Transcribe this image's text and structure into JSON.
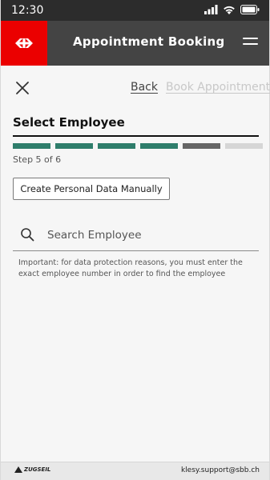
{
  "status_bar": {
    "time": "12:30",
    "icons": [
      "signal-icon",
      "wifi-icon",
      "battery-icon"
    ]
  },
  "header": {
    "title": "Appointment Booking",
    "logo_icon": "sbb-logo-icon",
    "brand_color": "#eb0000",
    "background_color": "#444444",
    "menu_icon": "menu-icon"
  },
  "nav": {
    "close_icon": "close-icon",
    "back_label": "Back",
    "book_label": "Book Appointment"
  },
  "main": {
    "title": "Select Employee",
    "progress": {
      "current": 5,
      "total": 6,
      "segments": [
        "complete",
        "complete",
        "complete",
        "complete",
        "current",
        "pending"
      ],
      "colors": {
        "complete": "#2e7d6b",
        "current": "#666666",
        "pending": "#d6d6d6"
      }
    },
    "step_text": "Step 5 of 6",
    "manual_button_label": "Create Personal Data Manually",
    "search": {
      "placeholder": "Search Employee",
      "value": ""
    },
    "info_text": "Important: for data protection reasons, you must enter the exact employee number in order to find the employee"
  },
  "footer": {
    "logo_text": "ZUGSEIL",
    "email": "klesy.support@sbb.ch"
  }
}
